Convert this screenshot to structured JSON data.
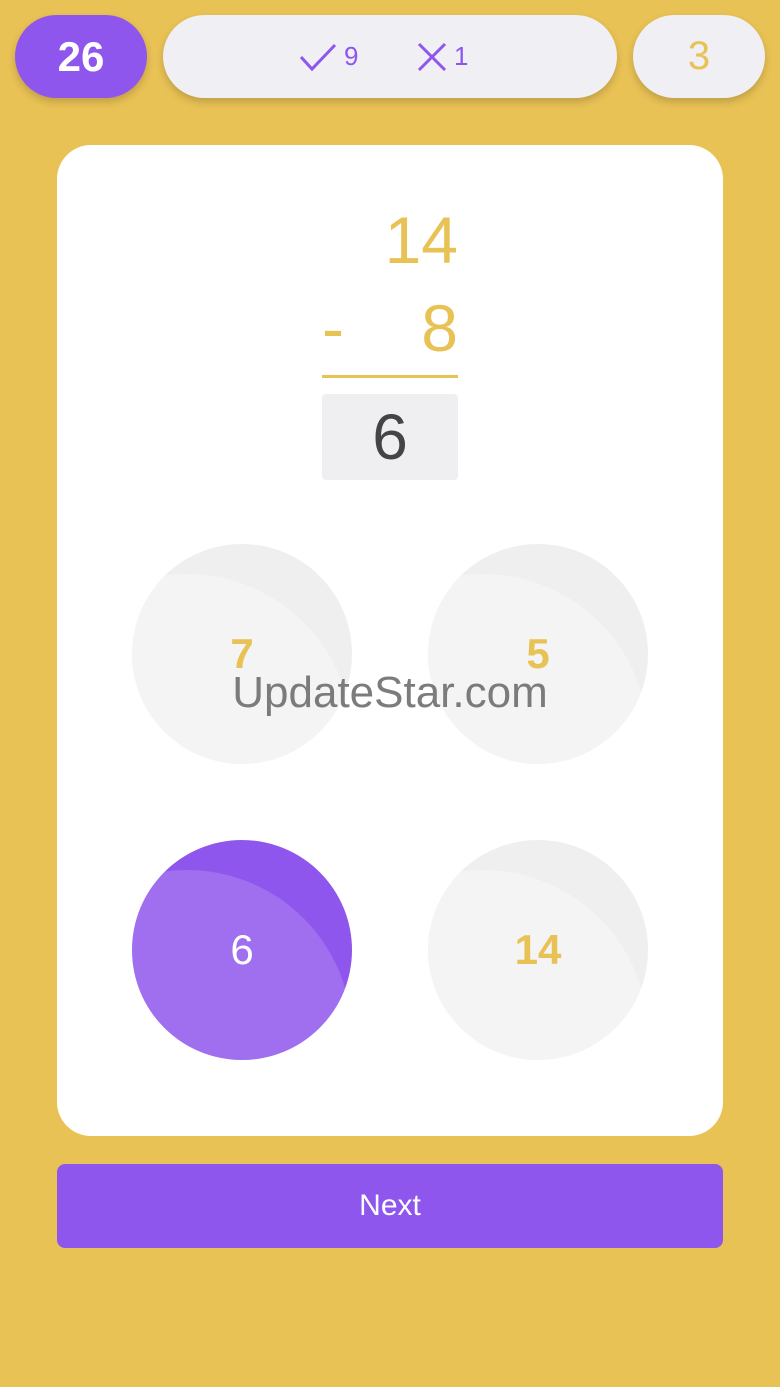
{
  "header": {
    "score": "26",
    "correct_count": "9",
    "wrong_count": "1",
    "level": "3"
  },
  "problem": {
    "top_number": "14",
    "operator": "-",
    "bottom_number": "8",
    "answer": "6"
  },
  "options": [
    {
      "label": "7",
      "selected": false
    },
    {
      "label": "5",
      "selected": false
    },
    {
      "label": "6",
      "selected": true
    },
    {
      "label": "14",
      "selected": false
    }
  ],
  "watermark": "UpdateStar.com",
  "next_label": "Next",
  "colors": {
    "background": "#E9C255",
    "accent": "#8F56EE",
    "pill": "#F0EFF4",
    "card": "#FFFFFF",
    "option_idle": "#EFEFEF"
  },
  "icons": {
    "correct": "check-icon",
    "wrong": "cross-icon"
  }
}
